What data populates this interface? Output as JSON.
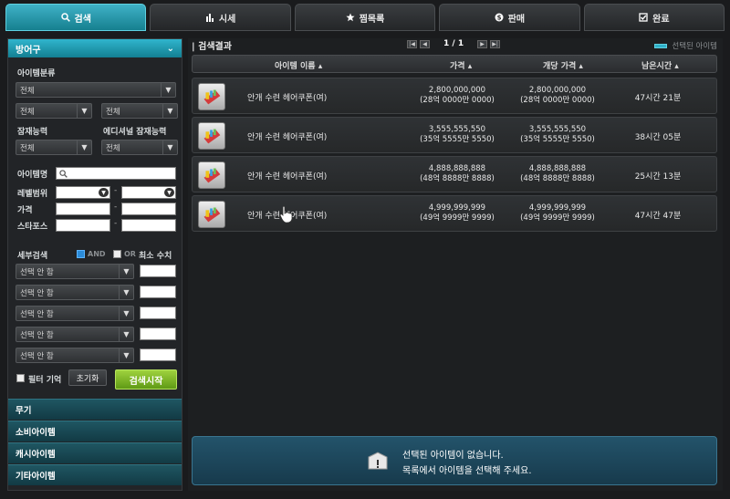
{
  "tabs": [
    {
      "label": "검색",
      "icon": "search-icon",
      "active": true
    },
    {
      "label": "시세",
      "icon": "bar-chart-icon",
      "active": false
    },
    {
      "label": "찜목록",
      "icon": "star-icon",
      "active": false
    },
    {
      "label": "판매",
      "icon": "coin-icon",
      "active": false
    },
    {
      "label": "완료",
      "icon": "check-box-icon",
      "active": false
    }
  ],
  "left": {
    "category": "방어구",
    "item_class_label": "아이템분류",
    "class_select": "전체",
    "sub1": "전체",
    "sub2": "전체",
    "potential_label": "잠재능력",
    "additional_label": "에디셔널 잠재능력",
    "potential_select": "전체",
    "additional_select": "전체",
    "item_name_label": "아이템명",
    "level_label": "레벨범위",
    "price_label": "가격",
    "stars_label": "스타포스",
    "detail_label": "세부검색",
    "and_label": "AND",
    "or_label": "OR",
    "min_label": "최소 수치",
    "detail_selects": [
      "선택 안 함",
      "선택 안 함",
      "선택 안 함",
      "선택 안 함",
      "선택 안 함"
    ],
    "filter_mem": "필터 기억",
    "reset": "초기화",
    "search": "검색시작",
    "categories": [
      "무기",
      "소비아이템",
      "캐시아이템",
      "기타아이템"
    ]
  },
  "results": {
    "title": "검색결과",
    "page": "1 / 1",
    "legend": "선택된 아이템",
    "headers": {
      "name": "아이템 이름",
      "price": "가격",
      "unit": "개당 가격",
      "time": "남은시간"
    },
    "rows": [
      {
        "name": "안개 수련 헤어쿠폰(여)",
        "price": "2,800,000,000",
        "price_kr": "(28억 0000만 0000)",
        "unit": "2,800,000,000",
        "unit_kr": "(28억 0000만 0000)",
        "time": "47시간 21분"
      },
      {
        "name": "안개 수련 헤어쿠폰(여)",
        "price": "3,555,555,550",
        "price_kr": "(35억 5555만 5550)",
        "unit": "3,555,555,550",
        "unit_kr": "(35억 5555만 5550)",
        "time": "38시간 05분"
      },
      {
        "name": "안개 수련 헤어쿠폰(여)",
        "price": "4,888,888,888",
        "price_kr": "(48억 8888만 8888)",
        "unit": "4,888,888,888",
        "unit_kr": "(48억 8888만 8888)",
        "time": "25시간 13분"
      },
      {
        "name": "안개 수련 헤어쿠폰(여)",
        "price": "4,999,999,999",
        "price_kr": "(49억 9999만 9999)",
        "unit": "4,999,999,999",
        "unit_kr": "(49억 9999만 9999)",
        "time": "47시간 47분"
      }
    ],
    "empty_line1": "선택된 아이템이 없습니다.",
    "empty_line2": "목록에서 아이템을 선택해 주세요."
  }
}
